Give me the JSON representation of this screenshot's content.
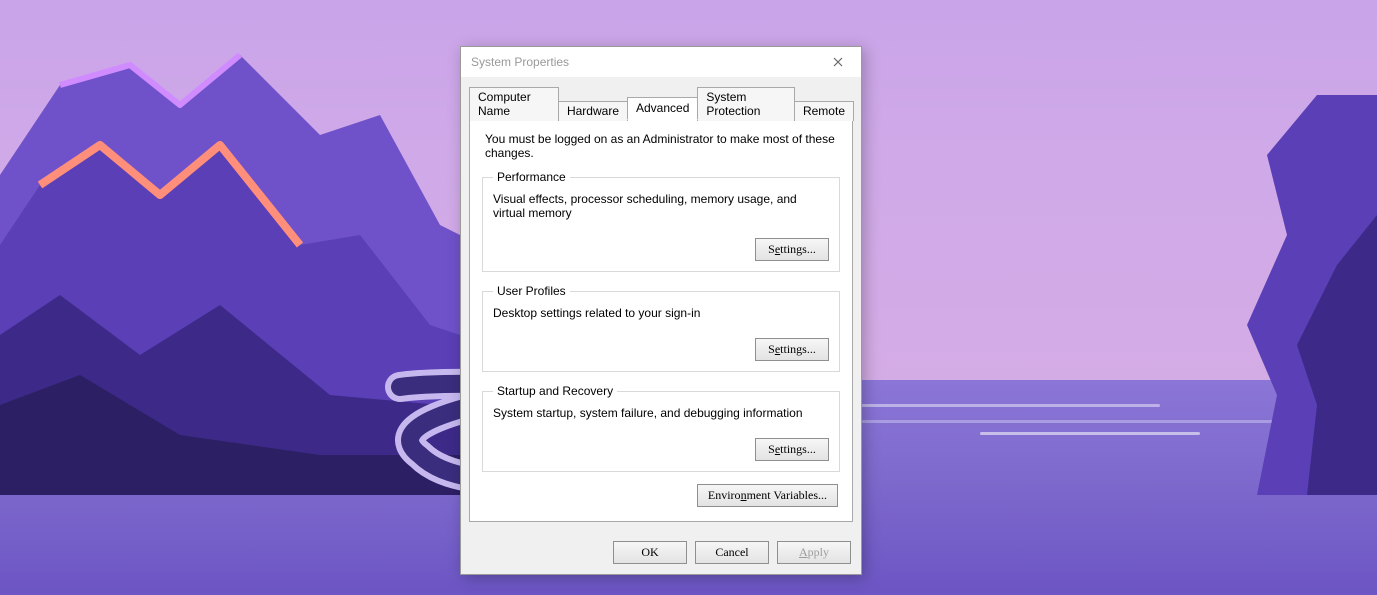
{
  "dialog": {
    "title": "System Properties",
    "intro": "You must be logged on as an Administrator to make most of these changes.",
    "tabs": [
      "Computer Name",
      "Hardware",
      "Advanced",
      "System Protection",
      "Remote"
    ],
    "active_tab": 2,
    "groups": {
      "performance": {
        "legend": "Performance",
        "desc": "Visual effects, processor scheduling, memory usage, and virtual memory",
        "button_pre": "S",
        "button_u": "e",
        "button_post": "ttings..."
      },
      "userprofiles": {
        "legend": "User Profiles",
        "desc": "Desktop settings related to your sign-in",
        "button_pre": "S",
        "button_u": "e",
        "button_post": "ttings..."
      },
      "startup": {
        "legend": "Startup and Recovery",
        "desc": "System startup, system failure, and debugging information",
        "button_pre": "S",
        "button_u": "e",
        "button_post": "ttings..."
      }
    },
    "env_button_pre": "Enviro",
    "env_button_u": "n",
    "env_button_post": "ment Variables...",
    "footer": {
      "ok": "OK",
      "cancel": "Cancel",
      "apply_u": "A",
      "apply_post": "pply"
    }
  }
}
